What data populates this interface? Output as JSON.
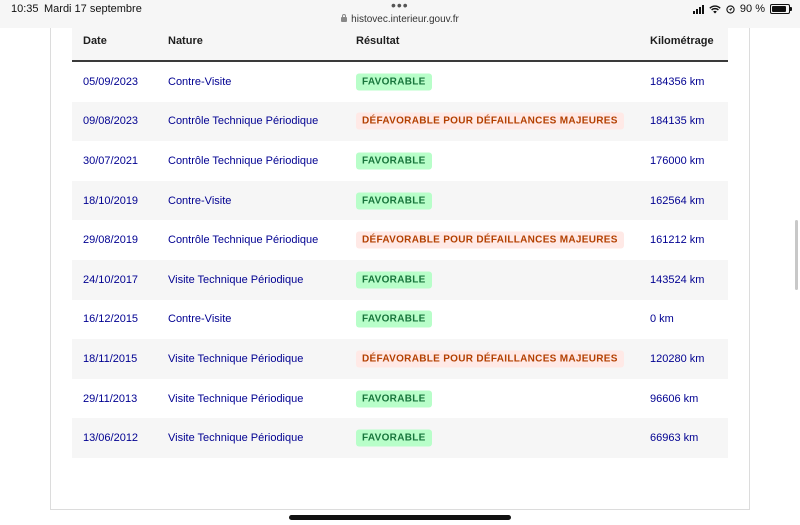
{
  "status_bar": {
    "time": "10:35",
    "date": "Mardi 17 septembre",
    "url": "histovec.interieur.gouv.fr",
    "battery": "90 %",
    "battery_level": 0.9
  },
  "table": {
    "headers": [
      "Date",
      "Nature",
      "Résultat",
      "Kilométrage"
    ],
    "rows": [
      {
        "date": "05/09/2023",
        "nature": "Contre-Visite",
        "result": "FAVORABLE",
        "status": "ok",
        "km": "184356 km"
      },
      {
        "date": "09/08/2023",
        "nature": "Contrôle Technique Périodique",
        "result": "DÉFAVORABLE POUR DÉFAILLANCES MAJEURES",
        "status": "ko",
        "km": "184135 km"
      },
      {
        "date": "30/07/2021",
        "nature": "Contrôle Technique Périodique",
        "result": "FAVORABLE",
        "status": "ok",
        "km": "176000 km"
      },
      {
        "date": "18/10/2019",
        "nature": "Contre-Visite",
        "result": "FAVORABLE",
        "status": "ok",
        "km": "162564 km"
      },
      {
        "date": "29/08/2019",
        "nature": "Contrôle Technique Périodique",
        "result": "DÉFAVORABLE POUR DÉFAILLANCES MAJEURES",
        "status": "ko",
        "km": "161212 km"
      },
      {
        "date": "24/10/2017",
        "nature": "Visite Technique Périodique",
        "result": "FAVORABLE",
        "status": "ok",
        "km": "143524 km"
      },
      {
        "date": "16/12/2015",
        "nature": "Contre-Visite",
        "result": "FAVORABLE",
        "status": "ok",
        "km": "0 km"
      },
      {
        "date": "18/11/2015",
        "nature": "Visite Technique Périodique",
        "result": "DÉFAVORABLE POUR DÉFAILLANCES MAJEURES",
        "status": "ko",
        "km": "120280 km"
      },
      {
        "date": "29/11/2013",
        "nature": "Visite Technique Périodique",
        "result": "FAVORABLE",
        "status": "ok",
        "km": "96606 km"
      },
      {
        "date": "13/06/2012",
        "nature": "Visite Technique Périodique",
        "result": "FAVORABLE",
        "status": "ok",
        "km": "66963 km"
      }
    ]
  },
  "colors": {
    "favorable_bg": "#b8fec9",
    "favorable_text": "#18753c",
    "defavorable_bg": "#ffe9e6",
    "defavorable_text": "#b34000",
    "link_text": "#000091"
  }
}
